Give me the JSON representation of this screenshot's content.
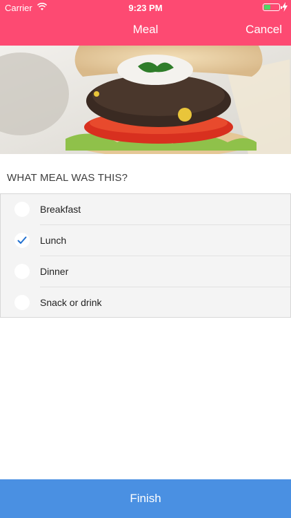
{
  "status_bar": {
    "carrier": "Carrier",
    "time": "9:23 PM"
  },
  "nav": {
    "title": "Meal",
    "cancel_label": "Cancel"
  },
  "hero": {
    "description_icon": "burger-photo"
  },
  "question": "WHAT MEAL WAS THIS?",
  "options": [
    {
      "label": "Breakfast",
      "selected": false
    },
    {
      "label": "Lunch",
      "selected": true
    },
    {
      "label": "Dinner",
      "selected": false
    },
    {
      "label": "Snack or drink",
      "selected": false
    }
  ],
  "finish_label": "Finish",
  "colors": {
    "header": "#fd4a72",
    "finish": "#4a90e2",
    "check": "#1f6fd0"
  }
}
